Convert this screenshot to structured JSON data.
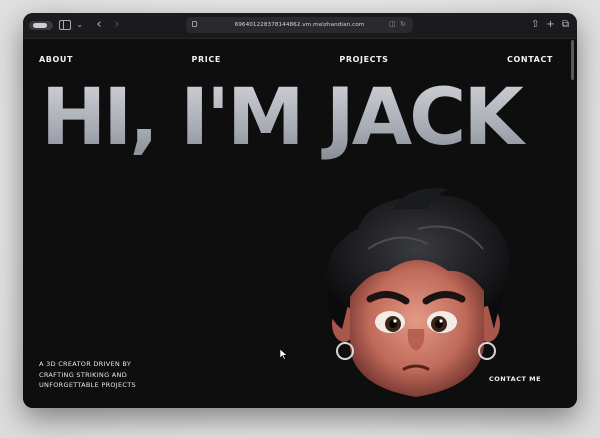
{
  "browser": {
    "url": "696401228378144862.vm.meizhandian.com",
    "icons": {
      "sidebar": "sidebar-icon",
      "back": "chevron-left-icon",
      "forward": "chevron-right-icon",
      "share": "share-icon",
      "new_tab": "plus-icon",
      "tabs": "tabs-overview-icon"
    }
  },
  "nav": {
    "about": "ABOUT",
    "price": "PRICE",
    "projects": "PROJECTS",
    "contact": "CONTACT"
  },
  "hero": {
    "title": "HI, I'M JACK"
  },
  "tagline": {
    "line1": "A 3D CREATOR DRIVEN BY",
    "line2": "CRAFTING STRIKING AND",
    "line3": "UNFORGETTABLE PROJECTS"
  },
  "cta": {
    "contact_me": "CONTACT ME"
  },
  "colors": {
    "page_bg": "#0e0e0f",
    "toolbar_bg": "#1b1b1d",
    "hero_text_top": "#d4d6da",
    "hero_text_bottom": "#7e838b",
    "nav_text": "#f1f1f1"
  }
}
